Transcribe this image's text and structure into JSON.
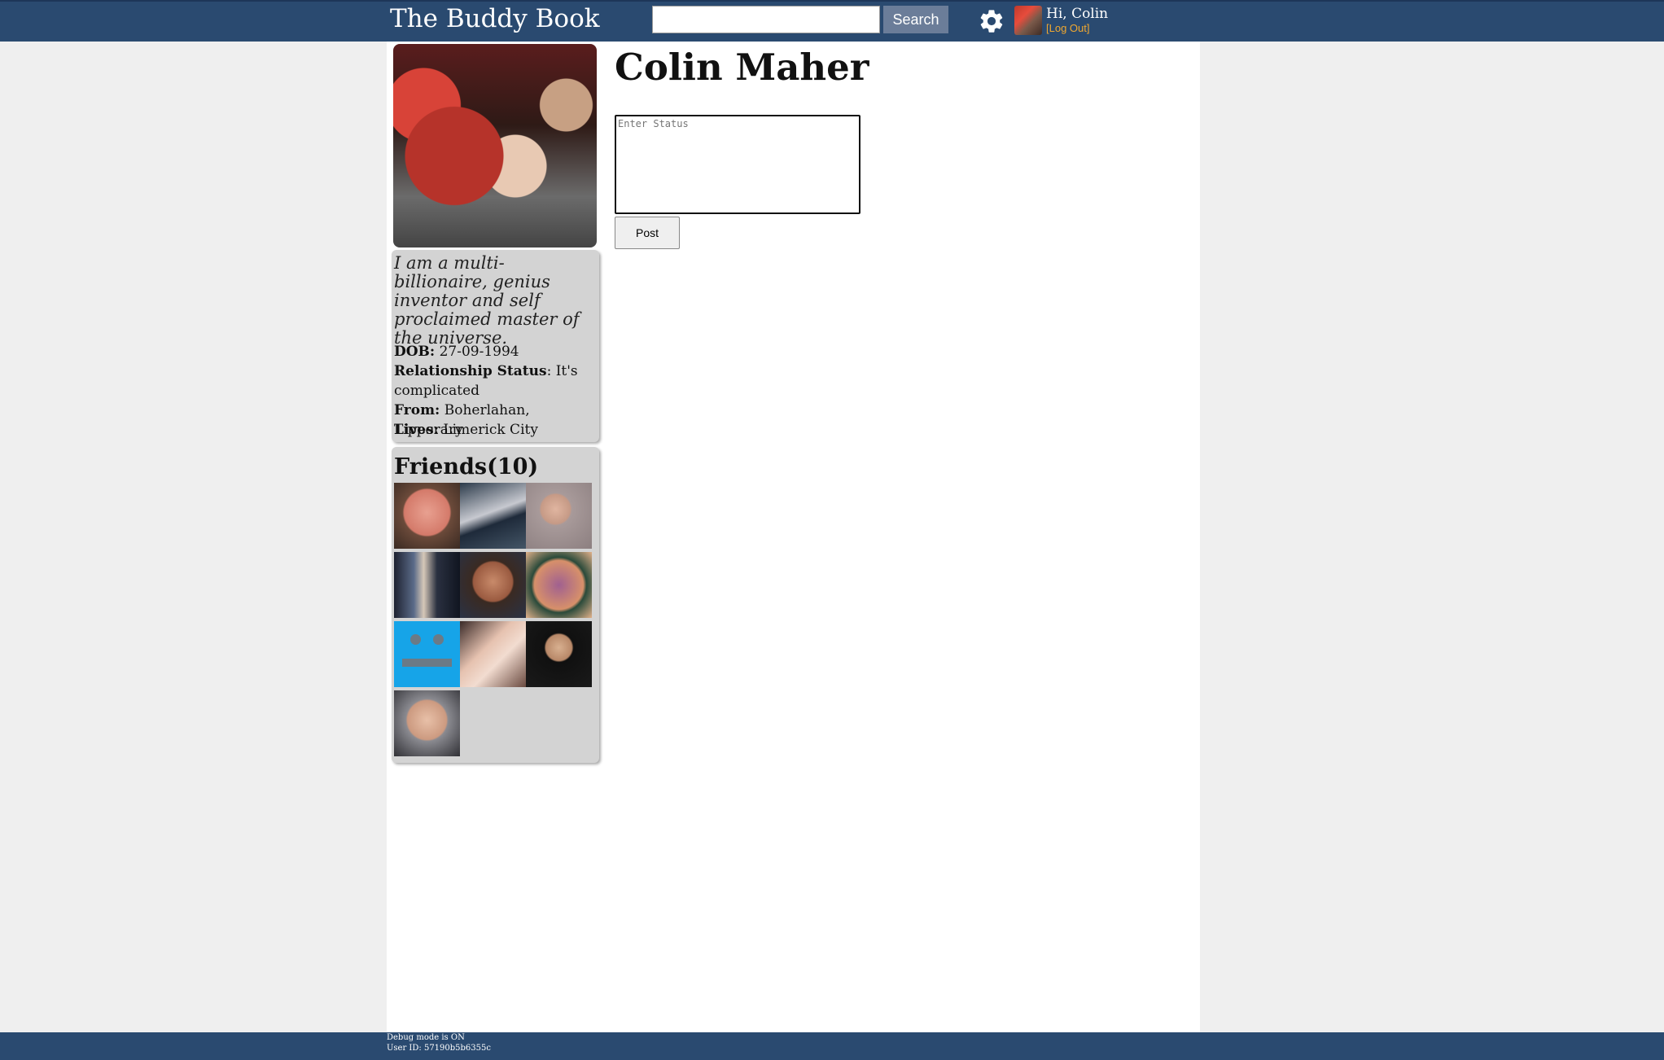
{
  "header": {
    "brand": "The Buddy Book",
    "search_placeholder": "",
    "search_label": "Search",
    "greeting": "Hi, Colin",
    "logout_label": "[Log Out]"
  },
  "profile": {
    "name": "Colin Maher",
    "bio": "I am a multi-billionaire, genius inventor and self proclaimed master of the universe.",
    "dob_label": "DOB:",
    "dob": "27-09-1994",
    "relationship_label": "Relationship Status",
    "relationship": ": It's complicated",
    "from_label": "From:",
    "from": "Boherlahan, Tipperary",
    "lives_label": "Lives:",
    "lives": "Limerick City"
  },
  "friends": {
    "title": "Friends(10)",
    "count": 10
  },
  "status": {
    "placeholder": "Enter Status",
    "post_label": "Post"
  },
  "footer": {
    "debug_mode": "Debug mode is ON",
    "user_id": "User ID: 57190b5b6355c"
  },
  "colors": {
    "topbar": "#2a4a70",
    "logout": "#f0a830",
    "card": "#d3d3d3"
  }
}
